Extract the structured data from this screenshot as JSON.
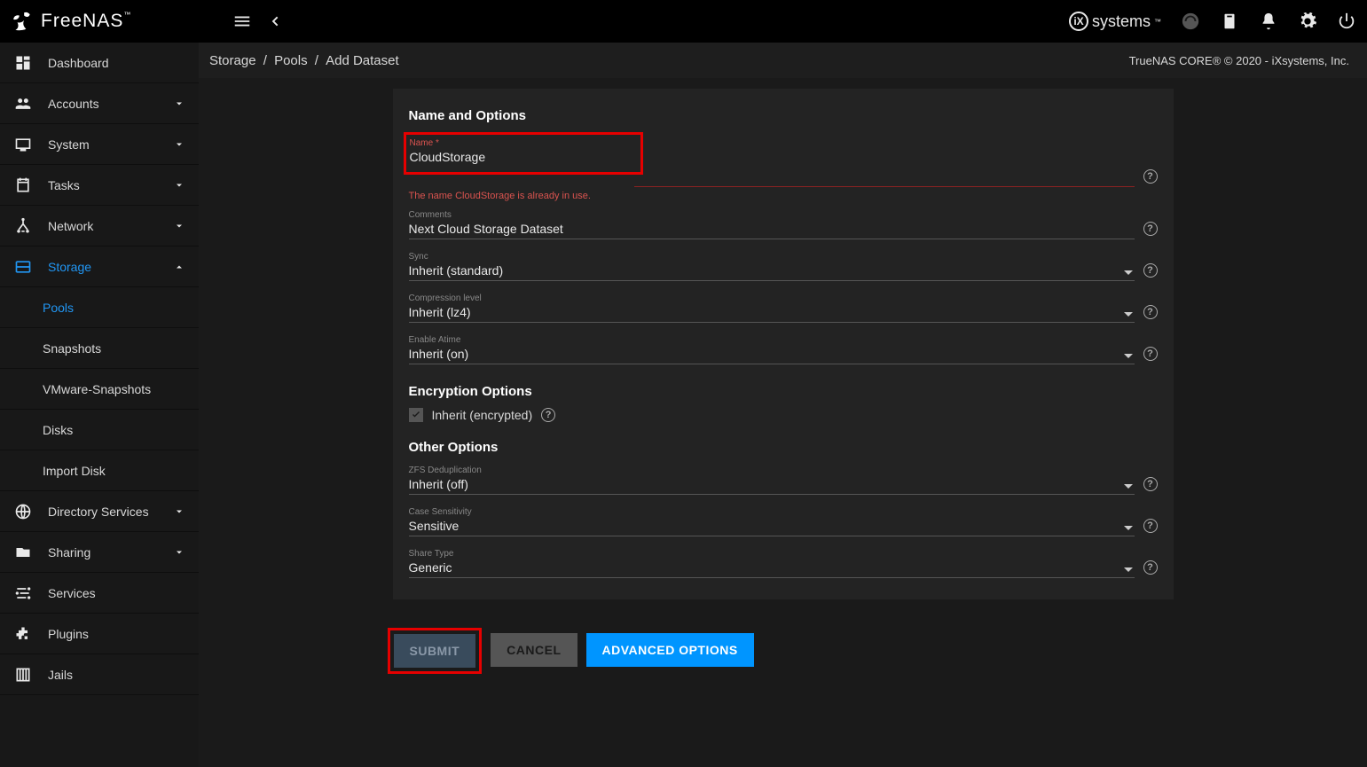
{
  "brand": "FreeNAS",
  "ix_brand": "systems",
  "copyright": "TrueNAS CORE® © 2020 - iXsystems, Inc.",
  "breadcrumb": [
    "Storage",
    "Pools",
    "Add Dataset"
  ],
  "sidebar": {
    "items": [
      {
        "label": "Dashboard",
        "icon": "dashboard",
        "expand": false,
        "active": false
      },
      {
        "label": "Accounts",
        "icon": "accounts",
        "expand": true,
        "active": false
      },
      {
        "label": "System",
        "icon": "system",
        "expand": true,
        "active": false
      },
      {
        "label": "Tasks",
        "icon": "tasks",
        "expand": true,
        "active": false
      },
      {
        "label": "Network",
        "icon": "network",
        "expand": true,
        "active": false
      },
      {
        "label": "Storage",
        "icon": "storage",
        "expand": true,
        "active": true,
        "open": true
      },
      {
        "label": "Directory Services",
        "icon": "dirsvc",
        "expand": true,
        "active": false
      },
      {
        "label": "Sharing",
        "icon": "sharing",
        "expand": true,
        "active": false
      },
      {
        "label": "Services",
        "icon": "services",
        "expand": false,
        "active": false
      },
      {
        "label": "Plugins",
        "icon": "plugins",
        "expand": false,
        "active": false
      },
      {
        "label": "Jails",
        "icon": "jails",
        "expand": false,
        "active": false
      }
    ],
    "storage_children": [
      {
        "label": "Pools",
        "active": true
      },
      {
        "label": "Snapshots",
        "active": false
      },
      {
        "label": "VMware-Snapshots",
        "active": false
      },
      {
        "label": "Disks",
        "active": false
      },
      {
        "label": "Import Disk",
        "active": false
      }
    ]
  },
  "form": {
    "section1_title": "Name and Options",
    "name_label": "Name *",
    "name_value": "CloudStorage",
    "name_error": "The name CloudStorage is already in use.",
    "comments_label": "Comments",
    "comments_value": "Next Cloud Storage Dataset",
    "sync_label": "Sync",
    "sync_value": "Inherit (standard)",
    "comp_label": "Compression level",
    "comp_value": "Inherit (lz4)",
    "atime_label": "Enable Atime",
    "atime_value": "Inherit (on)",
    "section2_title": "Encryption Options",
    "inherit_enc_label": "Inherit (encrypted)",
    "section3_title": "Other Options",
    "dedup_label": "ZFS Deduplication",
    "dedup_value": "Inherit (off)",
    "case_label": "Case Sensitivity",
    "case_value": "Sensitive",
    "share_label": "Share Type",
    "share_value": "Generic"
  },
  "buttons": {
    "submit": "Submit",
    "cancel": "Cancel",
    "advanced": "Advanced Options"
  }
}
